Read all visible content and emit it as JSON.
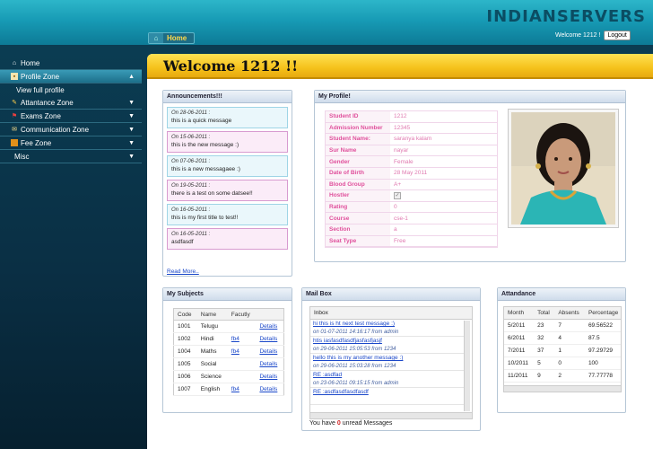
{
  "brand": "INDIANSERVERS",
  "breadcrumb": {
    "label": "Home"
  },
  "top_right": {
    "welcome": "Welcome 1212 !",
    "logout": "Logout"
  },
  "sidebar": {
    "items": [
      {
        "label": "Home",
        "icon": "home-icon"
      },
      {
        "label": "Profile Zone",
        "icon": "profile-icon"
      },
      {
        "label": "View full profile"
      },
      {
        "label": "Attantance Zone",
        "icon": "attendance-icon"
      },
      {
        "label": "Exams Zone",
        "icon": "exams-icon"
      },
      {
        "label": "Communication Zone",
        "icon": "communication-icon"
      },
      {
        "label": "Fee Zone",
        "icon": "fee-icon"
      },
      {
        "label": "Misc"
      }
    ]
  },
  "welcome_title": "Welcome 1212 !!",
  "announcements": {
    "title": "Announcements!!!",
    "items": [
      {
        "date": "On 28-06-2011 :",
        "text": "this is a quick message"
      },
      {
        "date": "On 15-06-2011 :",
        "text": "this is the new message :)"
      },
      {
        "date": "On 07-06-2011 :",
        "text": "this is a new messagaee :)"
      },
      {
        "date": "On 19-05-2011 :",
        "text": "there is a test on some datsee!!"
      },
      {
        "date": "On 16-05-2011 :",
        "text": "this is my first title to test!!"
      },
      {
        "date": "On 16-05-2011 :",
        "text": "asdfasdf"
      }
    ],
    "read_more": "Read More.."
  },
  "profile": {
    "title": "My Profile!",
    "rows": [
      {
        "k": "Student ID",
        "v": "1212"
      },
      {
        "k": "Admission Number",
        "v": "12345"
      },
      {
        "k": "Student Name:",
        "v": "saranya kalam"
      },
      {
        "k": "Sur Name",
        "v": "nayar"
      },
      {
        "k": "Gender",
        "v": "Female"
      },
      {
        "k": "Date of Birth",
        "v": "28 May 2011"
      },
      {
        "k": "Blood Group",
        "v": "A+"
      },
      {
        "k": "Hostler",
        "v": ""
      },
      {
        "k": "Rating",
        "v": "0"
      },
      {
        "k": "Course",
        "v": "cse-1"
      },
      {
        "k": "Section",
        "v": "a"
      },
      {
        "k": "Seat Type",
        "v": "Free"
      }
    ]
  },
  "subjects": {
    "title": "My Subjects",
    "headers": [
      "Code",
      "Name",
      "Facutly",
      ""
    ],
    "rows": [
      {
        "code": "1001",
        "name": "Telugu",
        "faculty": "",
        "details": "Details"
      },
      {
        "code": "1002",
        "name": "Hindi",
        "faculty": "fb4",
        "details": "Details"
      },
      {
        "code": "1004",
        "name": "Maths",
        "faculty": "fb4",
        "details": "Details"
      },
      {
        "code": "1005",
        "name": "Social",
        "faculty": "",
        "details": "Details"
      },
      {
        "code": "1006",
        "name": "Science",
        "faculty": "",
        "details": "Details"
      },
      {
        "code": "1007",
        "name": "English",
        "faculty": "fb4",
        "details": "Details"
      }
    ]
  },
  "mailbox": {
    "title": "Mail Box",
    "inbox_label": "Inbox",
    "items": [
      {
        "subject": "hi this is ht next test message :)",
        "meta": "on 01-07-2011 14:16:17 from admin"
      },
      {
        "subject": "htis iasfasdfasdfjasfasfjasjf",
        "meta": "on 29-06-2011 15:05:53 from 1234"
      },
      {
        "subject": "hello this is my another message :)",
        "meta": "on 29-06-2011 15:03:28 from 1234"
      },
      {
        "subject": "RE :asdfad",
        "meta": "on 23-06-2011 09:15:15 from admin"
      },
      {
        "subject": "RE :asdfasdfasdfasdf",
        "meta": ""
      }
    ],
    "unread_prefix": "You have",
    "unread_count": "0",
    "unread_suffix": "unread Messages"
  },
  "attendance": {
    "title": "Attandance",
    "headers": [
      "Month",
      "Total",
      "Absents",
      "Percentage"
    ],
    "rows": [
      {
        "month": "5/2011",
        "total": "23",
        "absents": "7",
        "pct": "69.56522"
      },
      {
        "month": "6/2011",
        "total": "32",
        "absents": "4",
        "pct": "87.5"
      },
      {
        "month": "7/2011",
        "total": "37",
        "absents": "1",
        "pct": "97.29729"
      },
      {
        "month": "10/2011",
        "total": "5",
        "absents": "0",
        "pct": "100"
      },
      {
        "month": "11/2011",
        "total": "9",
        "absents": "2",
        "pct": "77.77778"
      }
    ]
  },
  "colors": {
    "accent_yellow": "#f5c21b",
    "brand_teal": "#179bb5",
    "link": "#1a47c9",
    "profile_pink": "#e0509c"
  }
}
